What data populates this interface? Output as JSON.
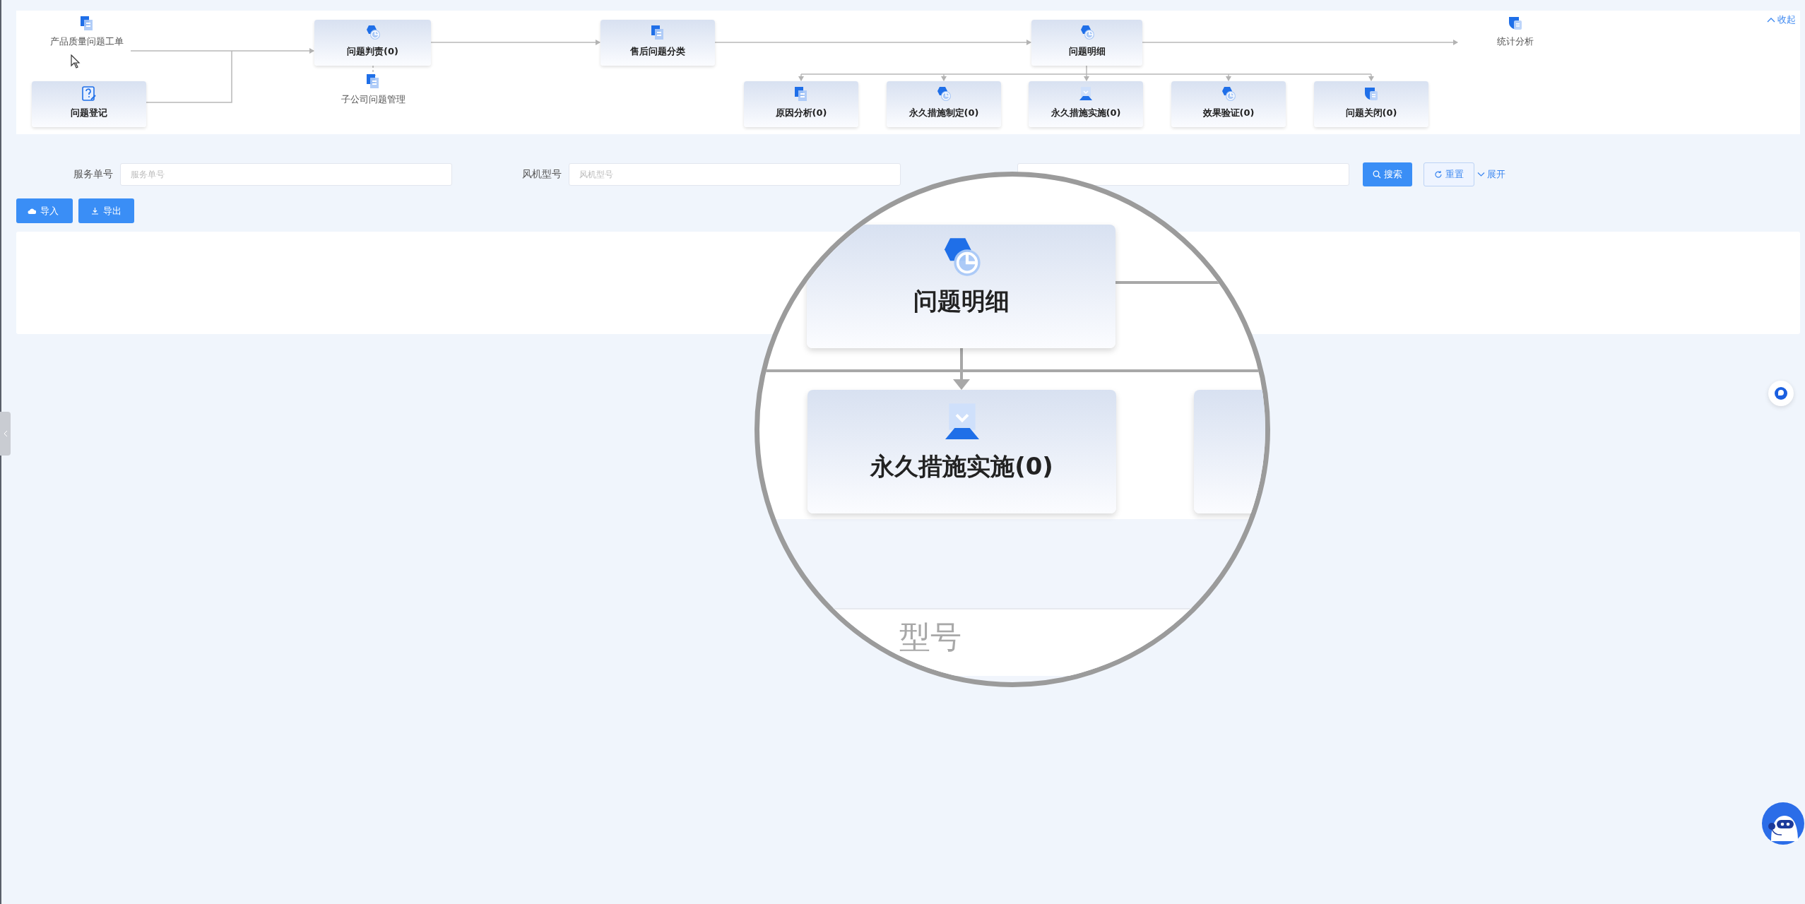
{
  "flow": {
    "collapse": {
      "label": "收起",
      "expanded": true
    },
    "nodes": [
      {
        "label": "产品质量问题工单",
        "kind": "plain"
      },
      {
        "label": "问题登记",
        "kind": "card"
      },
      {
        "label": "问题判责(0)",
        "kind": "card"
      },
      {
        "label": "子公司问题管理",
        "kind": "plain"
      },
      {
        "label": "售后问题分类",
        "kind": "card"
      },
      {
        "label": "问题明细",
        "kind": "card"
      },
      {
        "label": "统计分析",
        "kind": "plain"
      },
      {
        "label": "原因分析(0)",
        "kind": "card"
      },
      {
        "label": "永久措施制定(0)",
        "kind": "card"
      },
      {
        "label": "永久措施实施(0)",
        "kind": "card"
      },
      {
        "label": "效果验证(0)",
        "kind": "card"
      },
      {
        "label": "问题关闭(0)",
        "kind": "card"
      }
    ]
  },
  "search": {
    "fields": [
      {
        "label": "服务单号",
        "placeholder": "服务单号"
      },
      {
        "label": "风机型号",
        "placeholder": "风机型号"
      }
    ],
    "search_button": "搜索",
    "reset_button": "重置",
    "expand_link": "展开"
  },
  "actions": [
    {
      "label": "导入",
      "kind": "import"
    },
    {
      "label": "导出",
      "kind": "export"
    }
  ],
  "magnifier": {
    "cards": [
      {
        "label": "问题明细"
      },
      {
        "label": "永久措施实施(0)"
      }
    ],
    "field_label": "型号"
  }
}
